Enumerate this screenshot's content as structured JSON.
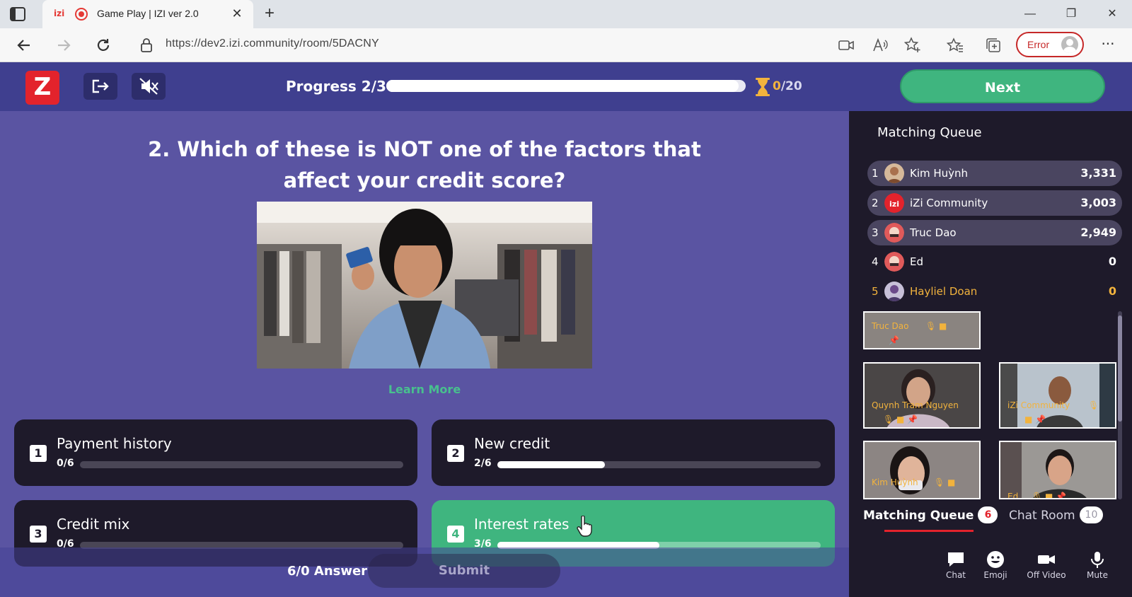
{
  "browser": {
    "tab_favicon": "izi",
    "tab_title": "Game Play | IZI ver 2.0",
    "url": "https://dev2.izi.community/room/5DACNY",
    "profile_status": "Error",
    "window_buttons": [
      "minimize-icon",
      "restore-icon",
      "close-icon"
    ]
  },
  "topbar": {
    "logo_letter": "Z",
    "progress_label": "Progress 2/3",
    "progress_fraction": 0.98,
    "timer_current": "0",
    "timer_total": "/20",
    "next_label": "Next",
    "accent_color": "#3fb57f",
    "brand_color": "#e3232c"
  },
  "question": {
    "text": "2. Which of these is NOT one of the factors that affect your credit score?",
    "learn_more": "Learn More"
  },
  "answers": [
    {
      "num": "1",
      "label": "Payment history",
      "count": "0/6",
      "fraction": 0.0,
      "selected": false
    },
    {
      "num": "2",
      "label": "New credit",
      "count": "2/6",
      "fraction": 0.333,
      "selected": false
    },
    {
      "num": "3",
      "label": "Credit mix",
      "count": "0/6",
      "fraction": 0.0,
      "selected": false
    },
    {
      "num": "4",
      "label": "Interest rates",
      "count": "3/6",
      "fraction": 0.5,
      "selected": true
    }
  ],
  "footer": {
    "answer_count": "6/0 Answer",
    "submit_label": "Submit"
  },
  "panel": {
    "title": "Matching Queue",
    "leaderboard": [
      {
        "rank": "1",
        "name": "Kim Huỳnh",
        "score": "3,331"
      },
      {
        "rank": "2",
        "name": "iZi Community",
        "score": "3,003"
      },
      {
        "rank": "3",
        "name": "Truc Dao",
        "score": "2,949"
      },
      {
        "rank": "4",
        "name": "Ed",
        "score": "0"
      },
      {
        "rank": "5",
        "name": "Hayliel Doan",
        "score": "0"
      }
    ],
    "videos": [
      {
        "name": "Truc Dao"
      },
      {
        "name": "Quynh Tram Nguyen"
      },
      {
        "name": "iZi Community"
      },
      {
        "name": "Kim Huỳnh"
      },
      {
        "name": "Ed"
      }
    ],
    "tabs": [
      {
        "label": "Matching Queue",
        "badge": "6"
      },
      {
        "label": "Chat Room",
        "badge": "10"
      }
    ],
    "actions": [
      {
        "label": "Chat",
        "icon": "chat-icon"
      },
      {
        "label": "Emoji",
        "icon": "emoji-icon"
      },
      {
        "label": "Off Video",
        "icon": "video-camera-icon"
      },
      {
        "label": "Mute",
        "icon": "microphone-icon"
      }
    ]
  }
}
